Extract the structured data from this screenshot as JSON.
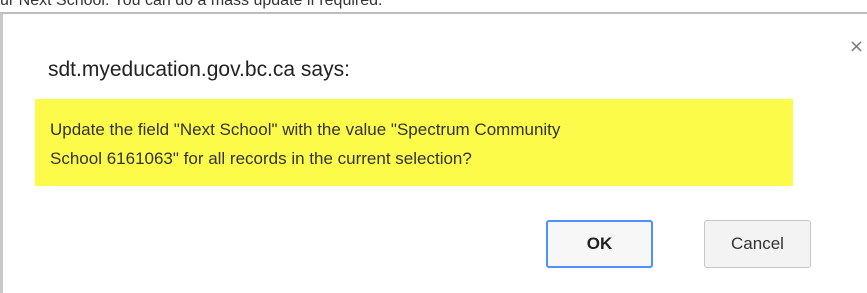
{
  "background": {
    "partial_text": "ur Next School. You can do a mass update if required."
  },
  "dialog": {
    "title": "sdt.myeducation.gov.bc.ca says:",
    "close_glyph": "×",
    "close_icon": "close-icon",
    "message_lines": [
      "Update the field \"Next School\" with the value \"Spectrum Community",
      "School 6161063\" for all records in the current selection?"
    ],
    "highlight_color": "#fdfb4a",
    "ok_label": "OK",
    "cancel_label": "Cancel",
    "ok_border_color": "#4d90fe"
  }
}
